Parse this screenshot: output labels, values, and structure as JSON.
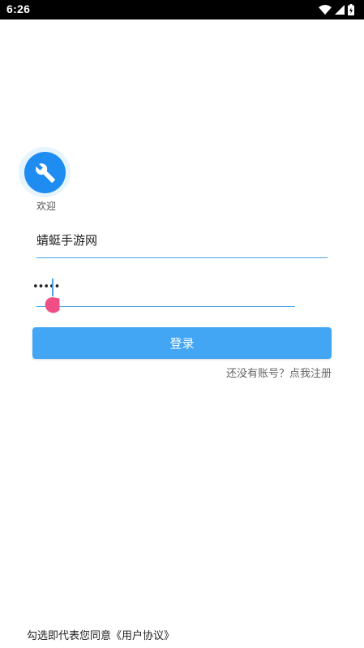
{
  "status_bar": {
    "time": "6:26",
    "icons": [
      "wifi-icon",
      "signal-icon",
      "battery-icon"
    ]
  },
  "logo": {
    "icon": "wrench-icon",
    "accent": "#1e8cf0"
  },
  "welcome_text": "欢迎",
  "username_field": {
    "value": "蜻蜓手游网"
  },
  "password_field": {
    "value_masked": "•••••"
  },
  "login_button": {
    "label": "登录",
    "color": "#42a6f5"
  },
  "register_link": {
    "label": "还没有账号？点我注册"
  },
  "agreement_text": "勾选即代表您同意《用户协议》"
}
